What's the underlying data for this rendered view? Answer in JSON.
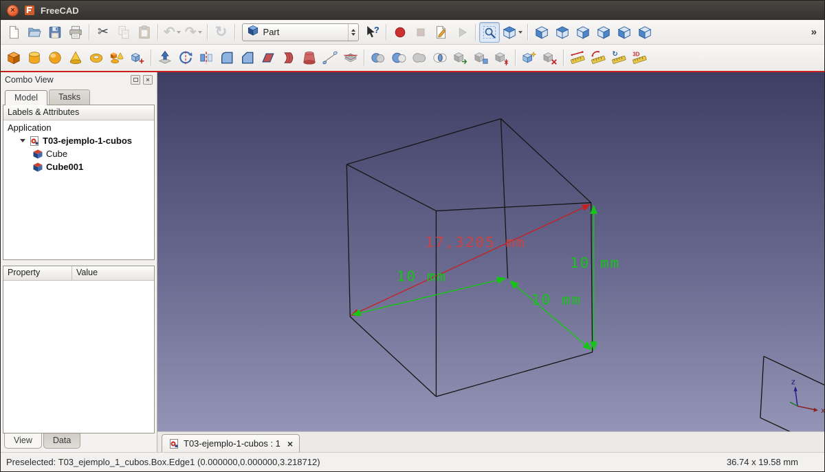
{
  "window": {
    "title": "FreeCAD"
  },
  "titlebar": {
    "close_glyph": "×"
  },
  "colors": {
    "viewport_gradient_top": "#3e3e64",
    "viewport_gradient_bottom": "#9494b6",
    "dimension_green": "#17c417",
    "dimension_red": "#c42222",
    "toolbar_underline_red": "#c81e1e",
    "ubuntu_close_orange": "#e2572c"
  },
  "toolbars": {
    "workbench_selector": {
      "value": "Part"
    },
    "standard": {
      "items": [
        {
          "type": "button",
          "name": "new-document"
        },
        {
          "type": "button",
          "name": "open-document"
        },
        {
          "type": "button",
          "name": "save-document"
        },
        {
          "type": "button",
          "name": "print"
        },
        {
          "type": "separator"
        },
        {
          "type": "button",
          "name": "cut"
        },
        {
          "type": "button",
          "name": "copy",
          "disabled": true
        },
        {
          "type": "button",
          "name": "paste",
          "disabled": true
        },
        {
          "type": "separator"
        },
        {
          "type": "button",
          "name": "undo",
          "disabled": true,
          "caret": true
        },
        {
          "type": "button",
          "name": "redo",
          "disabled": true,
          "caret": true
        },
        {
          "type": "separator"
        },
        {
          "type": "button",
          "name": "refresh",
          "disabled": true
        },
        {
          "type": "separator"
        },
        {
          "type": "workbench-combo",
          "name": "workbench-selector"
        },
        {
          "type": "button",
          "name": "whats-this"
        },
        {
          "type": "separator"
        },
        {
          "type": "button",
          "name": "macro-record"
        },
        {
          "type": "button",
          "name": "macro-stop",
          "disabled": true
        },
        {
          "type": "button",
          "name": "macro-edit"
        },
        {
          "type": "button",
          "name": "macro-execute",
          "disabled": true
        },
        {
          "type": "separator"
        },
        {
          "type": "button",
          "name": "view-fit-all",
          "active": true
        },
        {
          "type": "button",
          "name": "view-axonometric",
          "caret": true
        },
        {
          "type": "separator"
        },
        {
          "type": "button",
          "name": "view-front"
        },
        {
          "type": "button",
          "name": "view-top"
        },
        {
          "type": "button",
          "name": "view-right"
        },
        {
          "type": "button",
          "name": "view-rear"
        },
        {
          "type": "button",
          "name": "view-bottom"
        },
        {
          "type": "button",
          "name": "view-left"
        },
        {
          "type": "overflow",
          "label": "»"
        }
      ]
    },
    "part": {
      "items": [
        {
          "type": "button",
          "name": "part-box"
        },
        {
          "type": "button",
          "name": "part-cylinder"
        },
        {
          "type": "button",
          "name": "part-sphere"
        },
        {
          "type": "button",
          "name": "part-cone"
        },
        {
          "type": "button",
          "name": "part-torus"
        },
        {
          "type": "button",
          "name": "part-create-primitives"
        },
        {
          "type": "button",
          "name": "part-shape-builder"
        },
        {
          "type": "separator"
        },
        {
          "type": "button",
          "name": "part-extrude"
        },
        {
          "type": "button",
          "name": "part-revolve"
        },
        {
          "type": "button",
          "name": "part-mirror"
        },
        {
          "type": "button",
          "name": "part-fillet"
        },
        {
          "type": "button",
          "name": "part-chamfer"
        },
        {
          "type": "button",
          "name": "part-make-face"
        },
        {
          "type": "button",
          "name": "part-ruled-surface"
        },
        {
          "type": "button",
          "name": "part-loft"
        },
        {
          "type": "button",
          "name": "part-sweep"
        },
        {
          "type": "button",
          "name": "part-section"
        },
        {
          "type": "separator"
        },
        {
          "type": "button",
          "name": "part-boolean"
        },
        {
          "type": "button",
          "name": "part-cut"
        },
        {
          "type": "button",
          "name": "part-union"
        },
        {
          "type": "button",
          "name": "part-intersection"
        },
        {
          "type": "button",
          "name": "part-join-connect"
        },
        {
          "type": "button",
          "name": "part-compound"
        },
        {
          "type": "button",
          "name": "part-explode-compound"
        },
        {
          "type": "separator"
        },
        {
          "type": "button",
          "name": "part-refine-shape"
        },
        {
          "type": "button",
          "name": "part-defeaturing"
        },
        {
          "type": "separator"
        },
        {
          "type": "button",
          "name": "measure-linear"
        },
        {
          "type": "button",
          "name": "measure-angular"
        },
        {
          "type": "button",
          "name": "measure-refresh"
        },
        {
          "type": "button",
          "name": "measure-toggle-3d"
        }
      ]
    }
  },
  "combo_view": {
    "title": "Combo View",
    "window_buttons": [
      "float-window-icon",
      "close-panel-icon"
    ],
    "tabs": [
      "Model",
      "Tasks"
    ],
    "tree_header": "Labels & Attributes",
    "tree": [
      {
        "label": "Application",
        "depth": 0,
        "bold": false,
        "icon": null,
        "expander": null
      },
      {
        "label": "T03-ejemplo-1-cubos",
        "depth": 1,
        "bold": true,
        "icon": "document",
        "expander": "open"
      },
      {
        "label": "Cube",
        "depth": 2,
        "bold": false,
        "icon": "cube",
        "expander": null
      },
      {
        "label": "Cube001",
        "depth": 2,
        "bold": true,
        "icon": "cube",
        "expander": null
      }
    ],
    "property_table": {
      "headers": [
        "Property",
        "Value"
      ],
      "rows": []
    },
    "bottom_tabs": [
      "View",
      "Data"
    ]
  },
  "viewport": {
    "mdi_tab": {
      "label": "T03-ejemplo-1-cubos : 1",
      "close_glyph": "×"
    },
    "dimensions": {
      "diagonal": {
        "text": "17,3205 mm",
        "color": "#c94444"
      },
      "bottom_left_edge": {
        "text": "10 mm",
        "color": "#17c417"
      },
      "bottom_right_edge": {
        "text": "10 mm",
        "color": "#17c417"
      },
      "right_vertical_edge": {
        "text": "10 mm",
        "color": "#17c417"
      }
    },
    "axis": {
      "x": "x",
      "z": "z"
    }
  },
  "status_bar": {
    "message": "Preselected: T03_ejemplo_1_cubos.Box.Edge1 (0.000000,0.000000,3.218712)",
    "size_indicator": "36.74 x 19.58 mm"
  }
}
